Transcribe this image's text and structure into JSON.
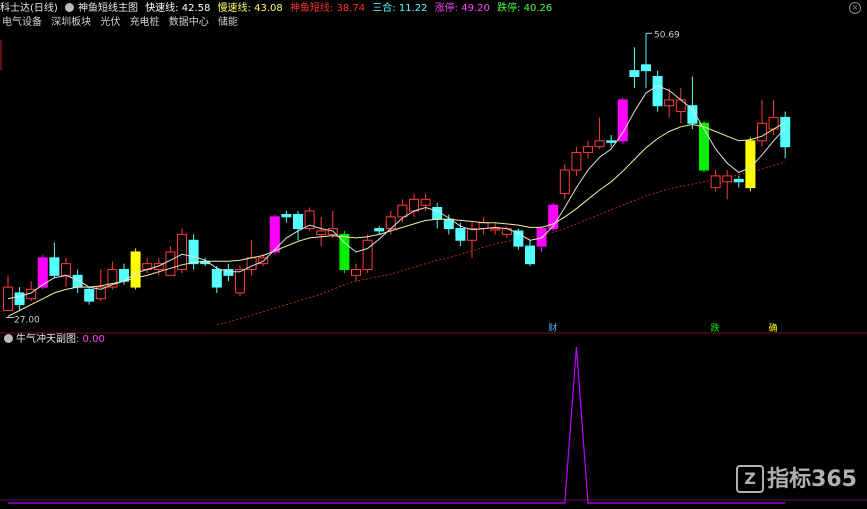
{
  "header": {
    "stock_name": "科士达(日线)",
    "indicator_name": "神鱼短线主图",
    "fast_label": "快速线: 42.58",
    "slow_label": "慢速线: 43.08",
    "shenyu_label": "神鱼短线: 38.74",
    "sanhe_label": "三合: 11.22",
    "zhangting_label": "涨停: 49.20",
    "dieting_label": "跌停: 40.26"
  },
  "sectors": [
    "电气设备",
    "深圳板块",
    "光伏",
    "充电桩",
    "数据中心",
    "储能"
  ],
  "indicator_panel": {
    "name": "牛气冲天副图",
    "value": ": 0.00"
  },
  "watermark": "指标365",
  "colors": {
    "up": "#ff3c3c",
    "down": "#54ffff",
    "magenta": "#ff00ff",
    "green": "#00ee00",
    "yellow": "#ffff00",
    "ma_fast": "#e0e0e0",
    "ma_slow": "#f0f0a0",
    "trend": "#c02020",
    "spike": "#c000ff"
  },
  "chart_data": {
    "type": "candlestick",
    "price_annotations": {
      "high": "50.69",
      "low": "27.00"
    },
    "markers": [
      "财",
      "跌",
      "确"
    ],
    "candles": [
      {
        "o": 27.0,
        "c": 29.0,
        "h": 30.0,
        "l": 27.0,
        "t": "up"
      },
      {
        "o": 27.5,
        "c": 28.5,
        "h": 29.0,
        "l": 27.0,
        "t": "down"
      },
      {
        "o": 28.0,
        "c": 28.8,
        "h": 29.5,
        "l": 27.8,
        "t": "up"
      },
      {
        "o": 29.0,
        "c": 31.5,
        "h": 31.8,
        "l": 28.8,
        "t": "magenta"
      },
      {
        "o": 31.5,
        "c": 30.0,
        "h": 32.8,
        "l": 29.8,
        "t": "down"
      },
      {
        "o": 30.0,
        "c": 31.0,
        "h": 31.5,
        "l": 29.0,
        "t": "up"
      },
      {
        "o": 30.0,
        "c": 29.0,
        "h": 30.5,
        "l": 28.5,
        "t": "down"
      },
      {
        "o": 28.8,
        "c": 27.8,
        "h": 29.0,
        "l": 27.5,
        "t": "down"
      },
      {
        "o": 28.0,
        "c": 29.0,
        "h": 30.5,
        "l": 27.8,
        "t": "up"
      },
      {
        "o": 29.0,
        "c": 30.5,
        "h": 31.2,
        "l": 28.8,
        "t": "up"
      },
      {
        "o": 30.5,
        "c": 29.5,
        "h": 31.0,
        "l": 29.2,
        "t": "down"
      },
      {
        "o": 29.0,
        "c": 32.0,
        "h": 32.3,
        "l": 28.8,
        "t": "yellow"
      },
      {
        "o": 31.0,
        "c": 30.5,
        "h": 31.5,
        "l": 30.2,
        "t": "up"
      },
      {
        "o": 30.5,
        "c": 31.0,
        "h": 31.5,
        "l": 30.0,
        "t": "up"
      },
      {
        "o": 30.0,
        "c": 32.0,
        "h": 32.5,
        "l": 30.0,
        "t": "up"
      },
      {
        "o": 30.5,
        "c": 33.5,
        "h": 34.0,
        "l": 30.2,
        "t": "up"
      },
      {
        "o": 33.0,
        "c": 31.0,
        "h": 33.5,
        "l": 30.5,
        "t": "down"
      },
      {
        "o": 31.2,
        "c": 31.0,
        "h": 31.5,
        "l": 30.8,
        "t": "down"
      },
      {
        "o": 30.5,
        "c": 29.0,
        "h": 30.8,
        "l": 28.5,
        "t": "down"
      },
      {
        "o": 30.5,
        "c": 30.0,
        "h": 31.0,
        "l": 29.5,
        "t": "down"
      },
      {
        "o": 28.5,
        "c": 30.5,
        "h": 30.8,
        "l": 28.2,
        "t": "up"
      },
      {
        "o": 30.5,
        "c": 31.5,
        "h": 33.0,
        "l": 30.0,
        "t": "up"
      },
      {
        "o": 31.5,
        "c": 31.0,
        "h": 31.8,
        "l": 30.8,
        "t": "up"
      },
      {
        "o": 32.0,
        "c": 35.0,
        "h": 35.2,
        "l": 31.8,
        "t": "magenta"
      },
      {
        "o": 35.0,
        "c": 35.2,
        "h": 35.5,
        "l": 34.5,
        "t": "down"
      },
      {
        "o": 35.2,
        "c": 34.0,
        "h": 35.5,
        "l": 33.0,
        "t": "down"
      },
      {
        "o": 34.0,
        "c": 35.5,
        "h": 35.8,
        "l": 33.8,
        "t": "up"
      },
      {
        "o": 33.8,
        "c": 33.5,
        "h": 35.0,
        "l": 32.5,
        "t": "up"
      },
      {
        "o": 33.5,
        "c": 34.0,
        "h": 35.5,
        "l": 33.2,
        "t": "up"
      },
      {
        "o": 33.5,
        "c": 30.5,
        "h": 33.8,
        "l": 30.2,
        "t": "green"
      },
      {
        "o": 30.5,
        "c": 30.0,
        "h": 31.0,
        "l": 29.5,
        "t": "up"
      },
      {
        "o": 30.5,
        "c": 33.0,
        "h": 33.5,
        "l": 30.2,
        "t": "up"
      },
      {
        "o": 33.8,
        "c": 34.0,
        "h": 34.2,
        "l": 33.5,
        "t": "down"
      },
      {
        "o": 34.0,
        "c": 35.0,
        "h": 35.5,
        "l": 33.5,
        "t": "up"
      },
      {
        "o": 35.0,
        "c": 36.0,
        "h": 36.5,
        "l": 34.5,
        "t": "up"
      },
      {
        "o": 35.5,
        "c": 36.5,
        "h": 37.0,
        "l": 35.0,
        "t": "up"
      },
      {
        "o": 36.5,
        "c": 36.0,
        "h": 37.0,
        "l": 35.5,
        "t": "up"
      },
      {
        "o": 35.8,
        "c": 34.8,
        "h": 36.2,
        "l": 34.0,
        "t": "down"
      },
      {
        "o": 34.8,
        "c": 34.0,
        "h": 35.2,
        "l": 33.5,
        "t": "down"
      },
      {
        "o": 34.0,
        "c": 33.0,
        "h": 34.5,
        "l": 32.5,
        "t": "down"
      },
      {
        "o": 33.0,
        "c": 34.0,
        "h": 34.5,
        "l": 31.5,
        "t": "up"
      },
      {
        "o": 34.0,
        "c": 34.5,
        "h": 35.0,
        "l": 33.5,
        "t": "up"
      },
      {
        "o": 34.0,
        "c": 34.0,
        "h": 34.5,
        "l": 33.5,
        "t": "up"
      },
      {
        "o": 33.5,
        "c": 34.0,
        "h": 34.2,
        "l": 33.2,
        "t": "up"
      },
      {
        "o": 33.8,
        "c": 32.5,
        "h": 34.0,
        "l": 32.2,
        "t": "down"
      },
      {
        "o": 32.5,
        "c": 31.0,
        "h": 33.0,
        "l": 30.8,
        "t": "down"
      },
      {
        "o": 32.5,
        "c": 34.0,
        "h": 34.2,
        "l": 32.0,
        "t": "magenta"
      },
      {
        "o": 34.0,
        "c": 36.0,
        "h": 36.2,
        "l": 33.8,
        "t": "magenta"
      },
      {
        "o": 37.0,
        "c": 39.0,
        "h": 39.5,
        "l": 36.5,
        "t": "up"
      },
      {
        "o": 39.0,
        "c": 40.5,
        "h": 41.0,
        "l": 38.5,
        "t": "up"
      },
      {
        "o": 40.5,
        "c": 41.0,
        "h": 41.5,
        "l": 40.0,
        "t": "up"
      },
      {
        "o": 41.0,
        "c": 41.5,
        "h": 43.5,
        "l": 40.8,
        "t": "up"
      },
      {
        "o": 41.5,
        "c": 41.5,
        "h": 42.0,
        "l": 41.0,
        "t": "down"
      },
      {
        "o": 41.5,
        "c": 45.0,
        "h": 45.2,
        "l": 41.2,
        "t": "magenta"
      },
      {
        "o": 47.0,
        "c": 47.5,
        "h": 49.5,
        "l": 46.0,
        "t": "down"
      },
      {
        "o": 48.0,
        "c": 47.5,
        "h": 50.69,
        "l": 46.0,
        "t": "down"
      },
      {
        "o": 47.0,
        "c": 44.5,
        "h": 47.5,
        "l": 44.0,
        "t": "down"
      },
      {
        "o": 44.5,
        "c": 45.0,
        "h": 46.0,
        "l": 43.5,
        "t": "up"
      },
      {
        "o": 45.0,
        "c": 44.0,
        "h": 46.0,
        "l": 43.0,
        "t": "up"
      },
      {
        "o": 44.5,
        "c": 43.0,
        "h": 47.0,
        "l": 42.5,
        "t": "down"
      },
      {
        "o": 43.0,
        "c": 39.0,
        "h": 43.2,
        "l": 38.8,
        "t": "green"
      },
      {
        "o": 38.5,
        "c": 37.5,
        "h": 39.0,
        "l": 37.2,
        "t": "up"
      },
      {
        "o": 38.0,
        "c": 38.5,
        "h": 39.0,
        "l": 36.5,
        "t": "up"
      },
      {
        "o": 38.0,
        "c": 38.2,
        "h": 38.5,
        "l": 37.5,
        "t": "down"
      },
      {
        "o": 37.5,
        "c": 41.5,
        "h": 41.8,
        "l": 37.2,
        "t": "yellow"
      },
      {
        "o": 41.5,
        "c": 43.0,
        "h": 45.0,
        "l": 41.0,
        "t": "up"
      },
      {
        "o": 42.5,
        "c": 43.5,
        "h": 45.0,
        "l": 42.0,
        "t": "up"
      },
      {
        "o": 43.5,
        "c": 41.0,
        "h": 44.0,
        "l": 40.0,
        "t": "down"
      }
    ],
    "fast_line": [
      28.0,
      28.2,
      28.5,
      29.2,
      29.8,
      30.0,
      29.6,
      29.0,
      28.8,
      29.2,
      29.5,
      30.2,
      30.5,
      30.8,
      31.3,
      31.8,
      31.6,
      31.3,
      30.6,
      30.3,
      30.3,
      30.8,
      31.2,
      32.2,
      33.2,
      33.8,
      34.3,
      34.0,
      33.8,
      32.8,
      32.0,
      32.3,
      33.1,
      34.0,
      34.9,
      35.5,
      35.8,
      35.5,
      34.9,
      34.2,
      33.9,
      34.0,
      34.1,
      34.0,
      33.6,
      33.0,
      33.2,
      34.2,
      35.8,
      37.5,
      39.0,
      40.1,
      40.8,
      42.2,
      44.0,
      45.6,
      46.2,
      45.8,
      45.0,
      44.2,
      42.5,
      40.8,
      39.6,
      38.8,
      39.2,
      40.3,
      41.5,
      42.58
    ],
    "slow_line": [
      26.5,
      27.0,
      27.5,
      28.0,
      28.5,
      28.8,
      29.0,
      29.0,
      29.1,
      29.3,
      29.5,
      29.8,
      30.0,
      30.3,
      30.6,
      30.9,
      31.1,
      31.2,
      31.2,
      31.2,
      31.3,
      31.5,
      31.7,
      32.1,
      32.5,
      32.9,
      33.2,
      33.3,
      33.4,
      33.3,
      33.2,
      33.3,
      33.5,
      33.8,
      34.1,
      34.4,
      34.7,
      34.8,
      34.8,
      34.7,
      34.6,
      34.5,
      34.5,
      34.4,
      34.3,
      34.1,
      34.1,
      34.4,
      35.0,
      35.7,
      36.5,
      37.3,
      38.0,
      38.9,
      39.9,
      40.9,
      41.7,
      42.3,
      42.7,
      42.9,
      42.7,
      42.3,
      41.9,
      41.5,
      41.6,
      41.9,
      42.5,
      43.08
    ],
    "trend_line": [
      null,
      null,
      null,
      null,
      null,
      null,
      null,
      null,
      null,
      null,
      null,
      null,
      null,
      null,
      null,
      null,
      null,
      null,
      25.8,
      26.0,
      26.3,
      26.6,
      26.9,
      27.2,
      27.5,
      27.8,
      28.1,
      28.4,
      28.8,
      29.2,
      29.5,
      29.7,
      29.9,
      30.1,
      30.4,
      30.7,
      31.0,
      31.3,
      31.5,
      31.8,
      32.1,
      32.4,
      32.7,
      32.9,
      33.1,
      33.2,
      33.4,
      33.7,
      34.0,
      34.4,
      34.8,
      35.2,
      35.6,
      36.0,
      36.4,
      36.8,
      37.1,
      37.4,
      37.6,
      37.8,
      38.0,
      38.2,
      38.4,
      38.6,
      38.8,
      39.1,
      39.4,
      39.7
    ],
    "indicator": [
      0,
      0,
      0,
      0,
      0,
      0,
      0,
      0,
      0,
      0,
      0,
      0,
      0,
      0,
      0,
      0,
      0,
      0,
      0,
      0,
      0,
      0,
      0,
      0,
      0,
      0,
      0,
      0,
      0,
      0,
      0,
      0,
      0,
      0,
      0,
      0,
      0,
      0,
      0,
      0,
      0,
      0,
      0,
      0,
      0,
      0,
      0,
      0,
      0,
      1,
      0,
      0,
      0,
      0,
      0,
      0,
      0,
      0,
      0,
      0,
      0,
      0,
      0,
      0,
      0,
      0,
      0,
      0
    ]
  }
}
